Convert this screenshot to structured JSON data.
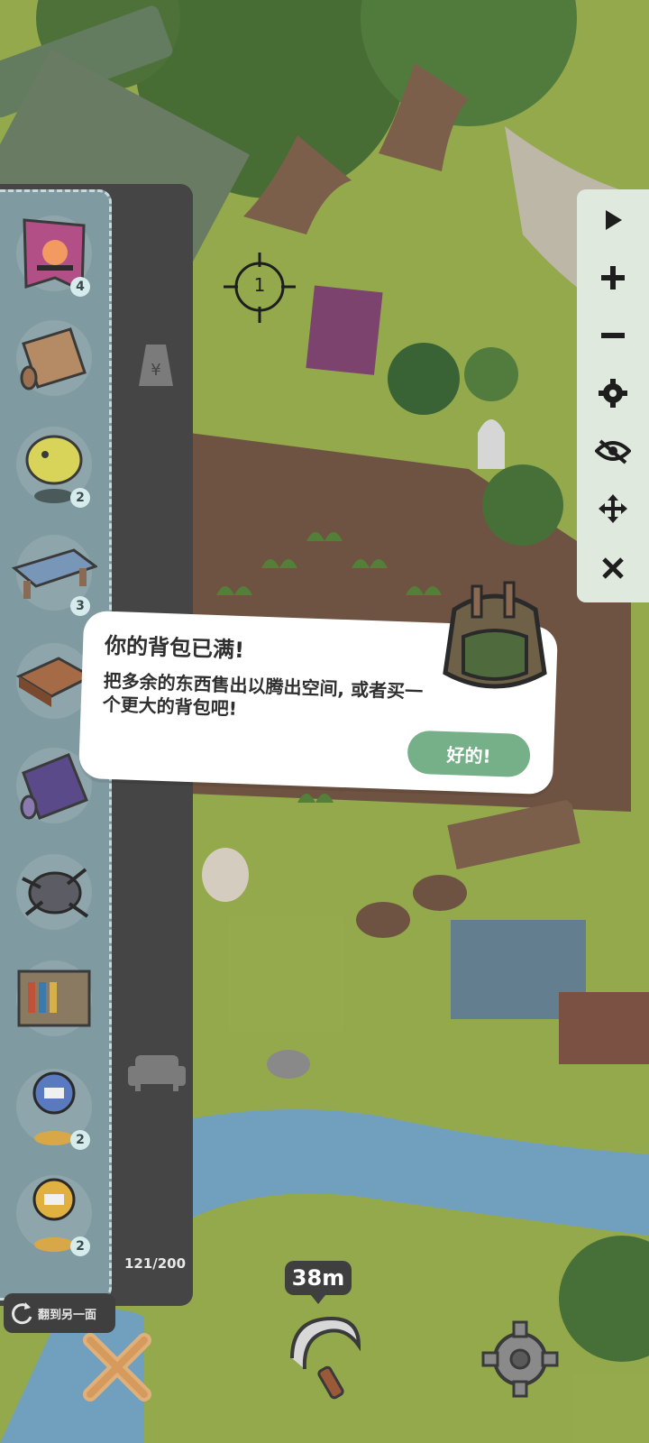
{
  "dialog": {
    "title": "你的背包已满!",
    "message": "把多余的东西售出以腾出空间, 或者买一个更大的背包吧!",
    "ok_label": "好的!"
  },
  "inventory": {
    "count": "121/200",
    "items": [
      {
        "icon": "sunset-banner-icon",
        "qty": "4"
      },
      {
        "icon": "scroll-map-icon",
        "qty": ""
      },
      {
        "icon": "fish-statue-icon",
        "qty": "2"
      },
      {
        "icon": "wooden-bench-icon",
        "qty": "3"
      },
      {
        "icon": "wooden-tray-icon",
        "qty": ""
      },
      {
        "icon": "purple-scroll-icon",
        "qty": ""
      },
      {
        "icon": "spiky-shell-icon",
        "qty": ""
      },
      {
        "icon": "bookshelf-icon",
        "qty": ""
      },
      {
        "icon": "robot-figure-blue-icon",
        "qty": "2"
      },
      {
        "icon": "robot-figure-gold-icon",
        "qty": "2"
      }
    ],
    "category_icons": [
      "price-tag-icon",
      "sofa-icon"
    ]
  },
  "toolbar": {
    "tools": [
      "play-icon",
      "zoom-in-icon",
      "zoom-out-icon",
      "settings-icon",
      "hide-icon",
      "move-icon",
      "close-icon"
    ]
  },
  "crosshair": {
    "label": "1"
  },
  "bottom": {
    "flip_label": "翻到另一面",
    "distance": "38m"
  },
  "colors": {
    "grass": "#a6bf55",
    "panel_dark": "#454545",
    "inventory_bg": "#7f9aa0",
    "ok_button": "#76b088"
  }
}
